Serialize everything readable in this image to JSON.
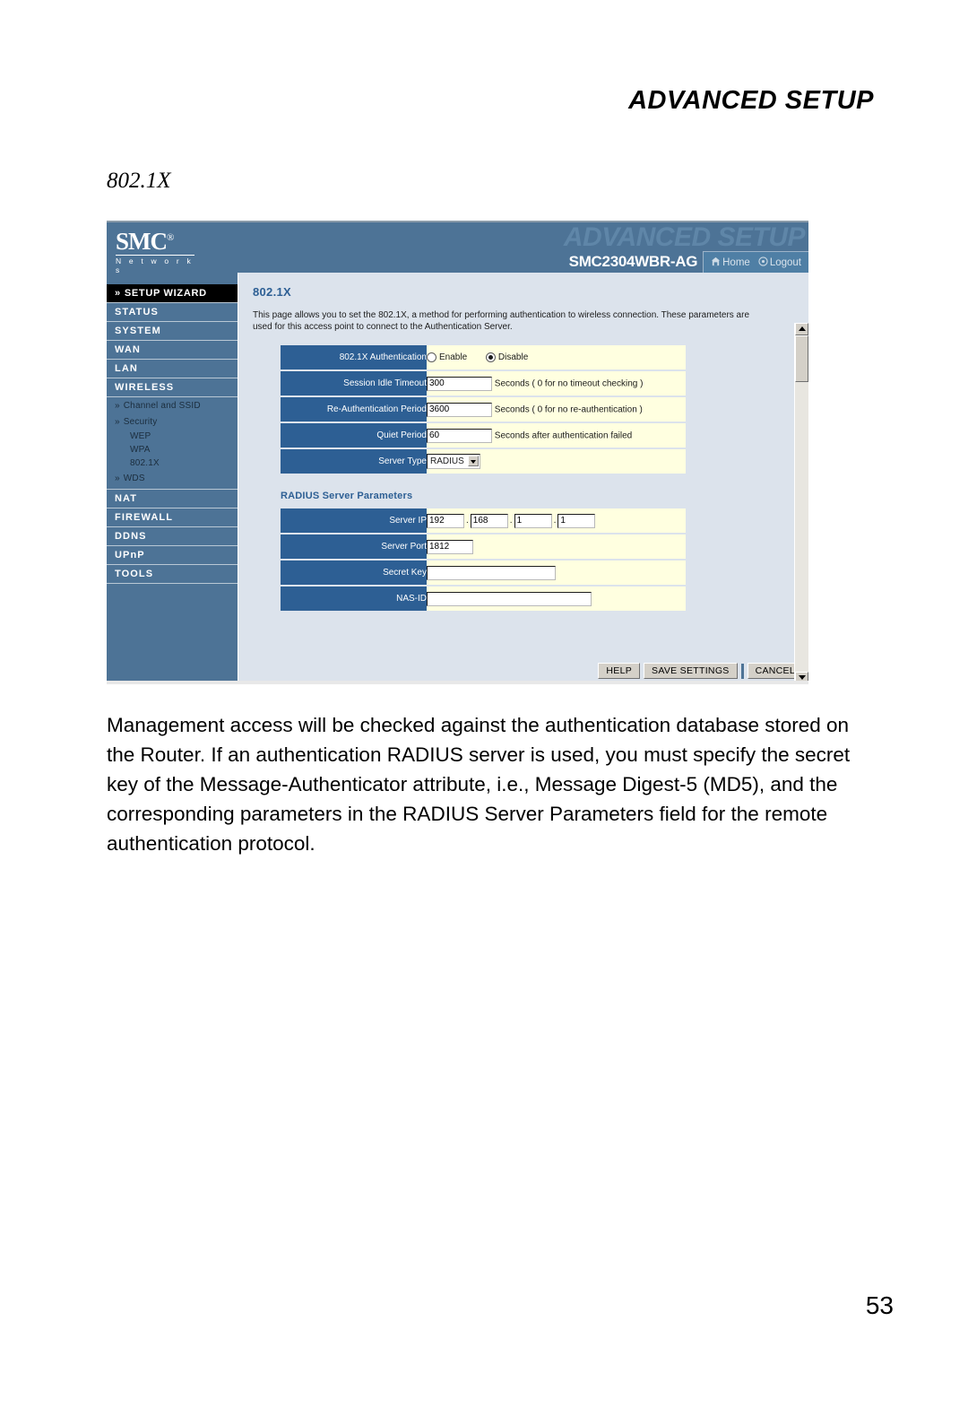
{
  "document": {
    "running_header": "ADVANCED SETUP",
    "section_title": "802.1X",
    "body_paragraph": "Management access will be checked against the authentication database stored on the Router. If an authentication RADIUS server is used, you must specify the secret key of the Message-Authenticator attribute, i.e., Message Digest-5 (MD5), and the corresponding parameters in the RADIUS Server Parameters field for the remote authentication protocol.",
    "page_number": "53"
  },
  "screenshot": {
    "brand": {
      "name": "SMC",
      "registered": "®",
      "tagline": "N e t w o r k s"
    },
    "header": {
      "watermark": "ADVANCED SETUP",
      "model": "SMC2304WBR-AG",
      "nav": [
        {
          "label": "Home",
          "icon": "home-icon"
        },
        {
          "label": "Logout",
          "icon": "logout-icon"
        }
      ]
    },
    "sidebar": {
      "wizard": {
        "label": "SETUP WIZARD",
        "chevron": "»"
      },
      "items": [
        {
          "label": "STATUS",
          "type": "top"
        },
        {
          "label": "SYSTEM",
          "type": "top"
        },
        {
          "label": "WAN",
          "type": "top"
        },
        {
          "label": "LAN",
          "type": "top"
        },
        {
          "label": "WIRELESS",
          "type": "top"
        }
      ],
      "wireless_sub": [
        {
          "label": "Channel and SSID",
          "chevron": "»",
          "level": 1
        },
        {
          "label": "Security",
          "chevron": "»",
          "level": 1
        },
        {
          "label": "WEP",
          "level": 2
        },
        {
          "label": "WPA",
          "level": 2
        },
        {
          "label": "802.1X",
          "level": 2
        },
        {
          "label": "WDS",
          "chevron": "»",
          "level": 1
        }
      ],
      "items_after": [
        {
          "label": "NAT",
          "type": "top"
        },
        {
          "label": "FIREWALL",
          "type": "top"
        },
        {
          "label": "DDNS",
          "type": "top"
        },
        {
          "label": "UPnP",
          "type": "top"
        },
        {
          "label": "TOOLS",
          "type": "top"
        }
      ]
    },
    "page": {
      "heading": "802.1X",
      "description": "This page allows you to set the 802.1X, a method for performing authentication to wireless connection.  These parameters are used for this access point to connect to the Authentication Server.",
      "fields": {
        "auth_label": "802.1X Authentication",
        "auth_enable": "Enable",
        "auth_disable": "Disable",
        "auth_selected": "Disable",
        "session_idle_label": "Session Idle Timeout",
        "session_idle_value": "300",
        "session_idle_hint": "Seconds ( 0 for no timeout checking )",
        "reauth_label": "Re-Authentication Period",
        "reauth_value": "3600",
        "reauth_hint": "Seconds ( 0 for no re-authentication )",
        "quiet_label": "Quiet Period",
        "quiet_value": "60",
        "quiet_hint": "Seconds after authentication failed",
        "server_type_label": "Server Type",
        "server_type_value": "RADIUS"
      },
      "radius": {
        "section_title": "RADIUS Server Parameters",
        "server_ip_label": "Server IP",
        "server_ip_octets": [
          "192",
          "168",
          "1",
          "1"
        ],
        "server_port_label": "Server Port",
        "server_port_value": "1812",
        "secret_key_label": "Secret Key",
        "secret_key_value": "",
        "nas_id_label": "NAS-ID",
        "nas_id_value": ""
      },
      "buttons": {
        "help": "HELP",
        "save": "SAVE SETTINGS",
        "cancel": "CANCEL"
      }
    },
    "colors": {
      "header_blue": "#4d7396",
      "label_blue": "#2d5f94",
      "content_bg": "#dce3ec",
      "field_bg": "#ffffe0",
      "button_face": "#d4d0c8"
    }
  }
}
